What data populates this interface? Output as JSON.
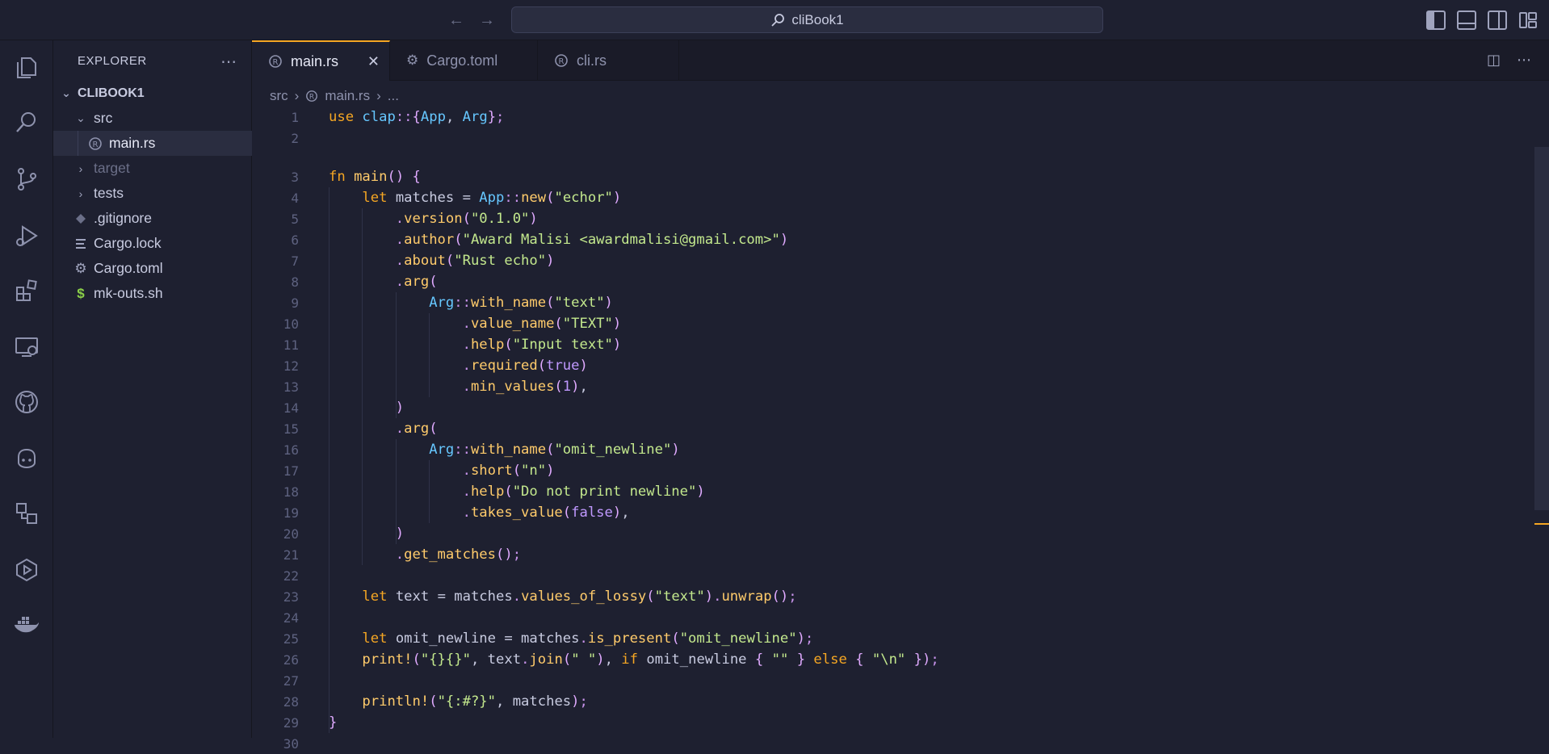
{
  "title_bar": {
    "search_text": "cliBook1"
  },
  "explorer": {
    "title": "EXPLORER",
    "root": "CLIBOOK1",
    "items": [
      {
        "label": "src",
        "kind": "folder-open",
        "depth": 1
      },
      {
        "label": "main.rs",
        "kind": "rust-file",
        "depth": 2,
        "selected": true
      },
      {
        "label": "target",
        "kind": "folder",
        "depth": 1,
        "dim": true
      },
      {
        "label": "tests",
        "kind": "folder",
        "depth": 1
      },
      {
        "label": ".gitignore",
        "kind": "git-file",
        "depth": 1
      },
      {
        "label": "Cargo.lock",
        "kind": "lock-file",
        "depth": 1
      },
      {
        "label": "Cargo.toml",
        "kind": "gear-file",
        "depth": 1
      },
      {
        "label": "mk-outs.sh",
        "kind": "shell-file",
        "depth": 1
      }
    ]
  },
  "tabs": [
    {
      "label": "main.rs",
      "active": true
    },
    {
      "label": "Cargo.toml",
      "active": false
    },
    {
      "label": "cli.rs",
      "active": false
    }
  ],
  "breadcrumb": {
    "parts": [
      "src",
      "main.rs",
      "..."
    ]
  },
  "code": {
    "lines": [
      {
        "n": "1",
        "text": "use clap::{App, Arg};"
      },
      {
        "n": "2",
        "text": ""
      },
      {
        "n": "3",
        "text": "fn main() {"
      },
      {
        "n": "4",
        "text": "    let matches = App::new(\"echor\")"
      },
      {
        "n": "5",
        "text": "        .version(\"0.1.0\")"
      },
      {
        "n": "6",
        "text": "        .author(\"Award Malisi <awardmalisi@gmail.com>\")"
      },
      {
        "n": "7",
        "text": "        .about(\"Rust echo\")"
      },
      {
        "n": "8",
        "text": "        .arg("
      },
      {
        "n": "9",
        "text": "            Arg::with_name(\"text\")"
      },
      {
        "n": "10",
        "text": "                .value_name(\"TEXT\")"
      },
      {
        "n": "11",
        "text": "                .help(\"Input text\")"
      },
      {
        "n": "12",
        "text": "                .required(true)"
      },
      {
        "n": "13",
        "text": "                .min_values(1),"
      },
      {
        "n": "14",
        "text": "        )"
      },
      {
        "n": "15",
        "text": "        .arg("
      },
      {
        "n": "16",
        "text": "            Arg::with_name(\"omit_newline\")"
      },
      {
        "n": "17",
        "text": "                .short(\"n\")"
      },
      {
        "n": "18",
        "text": "                .help(\"Do not print newline\")"
      },
      {
        "n": "19",
        "text": "                .takes_value(false),"
      },
      {
        "n": "20",
        "text": "        )"
      },
      {
        "n": "21",
        "text": "        .get_matches();"
      },
      {
        "n": "22",
        "text": ""
      },
      {
        "n": "23",
        "text": "    let text = matches.values_of_lossy(\"text\").unwrap();"
      },
      {
        "n": "24",
        "text": ""
      },
      {
        "n": "25",
        "text": "    let omit_newline = matches.is_present(\"omit_newline\");"
      },
      {
        "n": "26",
        "text": "    print!(\"{}{}\", text.join(\" \"), if omit_newline { \"\" } else { \"\\n\" });"
      },
      {
        "n": "27",
        "text": ""
      },
      {
        "n": "28",
        "text": "    println!(\"{:#?}\", matches);"
      },
      {
        "n": "29",
        "text": "}"
      },
      {
        "n": "30",
        "text": ""
      }
    ]
  },
  "colors": {
    "accent": "#f5a623",
    "background": "#1e2030"
  }
}
